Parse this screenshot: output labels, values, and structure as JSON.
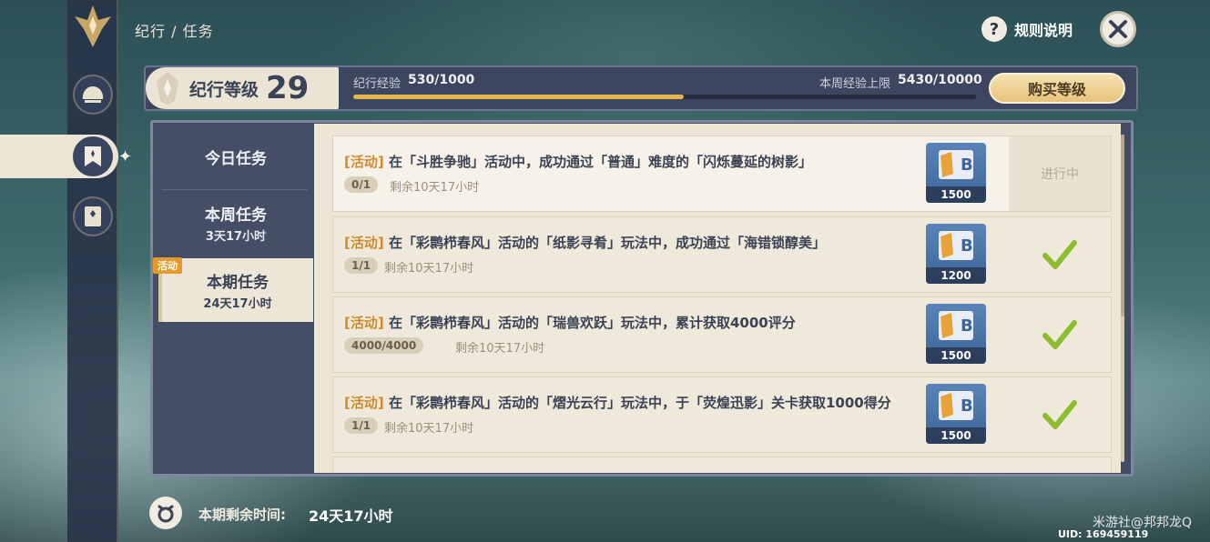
{
  "breadcrumb": "纪行 / 任务",
  "help": {
    "label": "规则说明",
    "icon": "question-icon"
  },
  "level": {
    "label": "纪行等级",
    "value": "29"
  },
  "experience": {
    "label": "纪行经验",
    "value": "530/1000",
    "progress": 0.53
  },
  "weekly_cap": {
    "label": "本周经验上限",
    "value": "5430/10000"
  },
  "buy_level_label": "购买等级",
  "tabs": [
    {
      "label": "今日任务",
      "sub": ""
    },
    {
      "label": "本周任务",
      "sub": "3天17小时"
    },
    {
      "label": "本期任务",
      "sub": "24天17小时",
      "badge": "活动",
      "active": true
    }
  ],
  "tasks": [
    {
      "tag": "[活动]",
      "text": "在「斗胜争驰」活动中，成功通过「普通」难度的「闪烁蔓延的树影」",
      "progress": "0/1",
      "remaining": "剩余10天17小时",
      "reward": "1500",
      "status": "进行中",
      "done": false
    },
    {
      "tag": "[活动]",
      "text": "在「彩鹮栉春风」活动的「纸影寻肴」玩法中，成功通过「海错锁醇美」",
      "progress": "1/1",
      "remaining": "剩余10天17小时",
      "reward": "1200",
      "status": "",
      "done": true
    },
    {
      "tag": "[活动]",
      "text": "在「彩鹮栉春风」活动的「瑞兽欢跃」玩法中，累计获取4000评分",
      "progress": "4000/4000",
      "remaining": "剩余10天17小时",
      "reward": "1500",
      "status": "",
      "done": true
    },
    {
      "tag": "[活动]",
      "text": "在「彩鹮栉春风」活动的「熠光云行」玩法中，于「荧煌迅影」关卡获取1000得分",
      "progress": "1/1",
      "remaining": "剩余10天17小时",
      "reward": "1500",
      "status": "",
      "done": true
    }
  ],
  "footer": {
    "label": "本期剩余时间:",
    "value": "24天17小时"
  },
  "watermark": "米游社@邦邦龙Q",
  "uid": "UID: 169459119",
  "colors": {
    "accent": "#e8b54c",
    "tag": "#d28a2a",
    "check": "#8bbd2c",
    "panel": "#424c62",
    "card": "#ede6d7"
  }
}
